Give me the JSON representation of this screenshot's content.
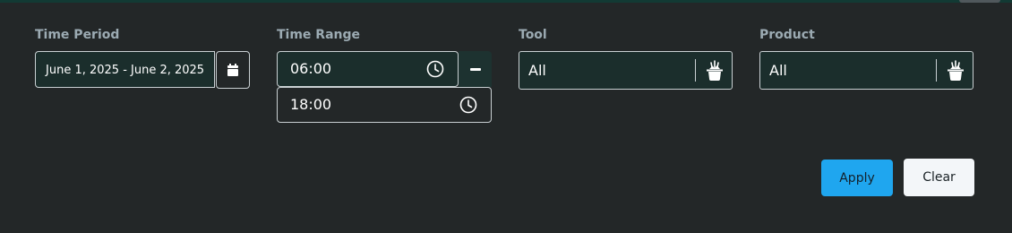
{
  "filters": {
    "time_period": {
      "label": "Time Period",
      "value": "June 1, 2025 - June 2, 2025",
      "calendar_icon": "calendar-icon"
    },
    "time_range": {
      "label": "Time Range",
      "start": "06:00",
      "end": "18:00",
      "clock_icon": "clock-icon",
      "remove_icon": "minus-icon"
    },
    "tool": {
      "label": "Tool",
      "value": "All",
      "icon": "bucket-clear-icon"
    },
    "product": {
      "label": "Product",
      "value": "All",
      "icon": "bucket-clear-icon"
    }
  },
  "actions": {
    "apply_label": "Apply",
    "clear_label": "Clear"
  },
  "colors": {
    "background": "#232728",
    "field_background": "#1b2e2c",
    "label": "#9cabb3",
    "apply": "#1fa6ef",
    "clear": "#f3f6f9"
  }
}
